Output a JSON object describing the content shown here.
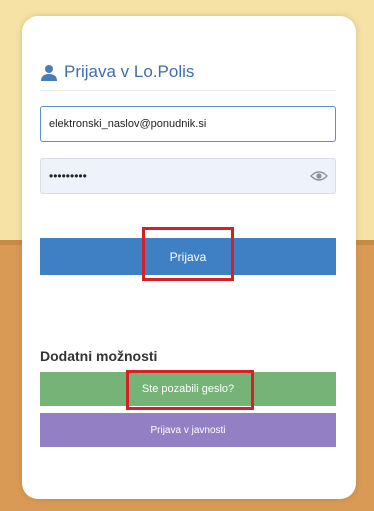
{
  "login": {
    "title": "Prijava v Lo.Polis",
    "title_icon": "user-icon",
    "email_value": "elektronski_naslov@ponudnik.si",
    "password_value": "•••••••••",
    "password_toggle_icon": "eye-icon",
    "submit_label": "Prijava"
  },
  "options": {
    "heading": "Dodatni možnosti",
    "forgot_label": "Ste pozabili geslo?",
    "public_label": "Prijava v javnosti"
  },
  "colors": {
    "accent_blue": "#3f80c4",
    "forgot_green": "#76b376",
    "public_purple": "#9380c4",
    "highlight_red": "#d42027",
    "background_top": "#f6e2a4",
    "background_bottom": "#d99a56"
  }
}
